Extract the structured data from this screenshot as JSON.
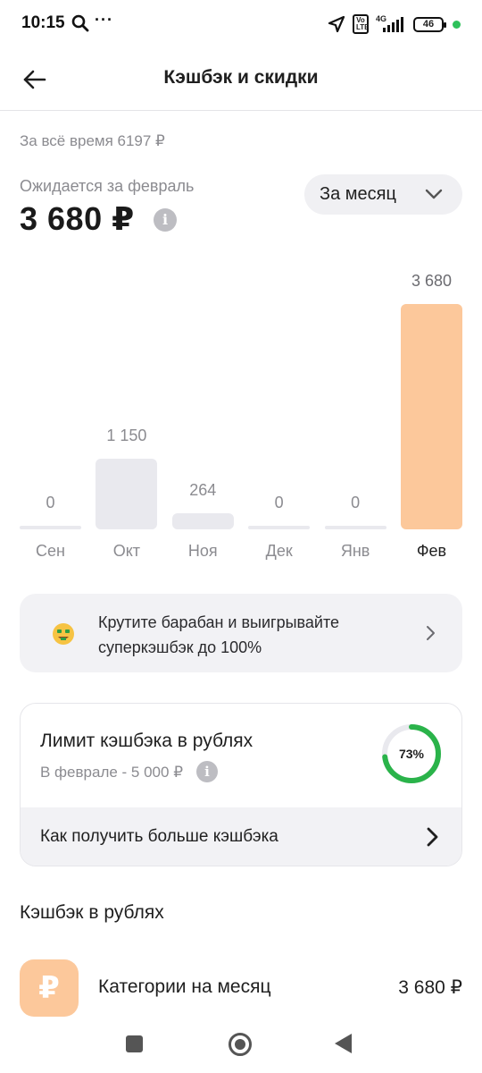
{
  "status_bar": {
    "time": "10:15",
    "dots": "···",
    "volte": "Vo LTE",
    "network": "4G",
    "battery": "46"
  },
  "header": {
    "title": "Кэшбэк и скидки"
  },
  "summary": {
    "total_all_time": "За всё время 6197 ₽",
    "expected_label": "Ожидается за февраль",
    "expected_amount": "3 680 ₽",
    "info_glyph": "i"
  },
  "period_select": {
    "value": "За месяц"
  },
  "chart_data": {
    "type": "bar",
    "categories": [
      "Сен",
      "Окт",
      "Ноя",
      "Дек",
      "Янв",
      "Фев"
    ],
    "values": [
      0,
      1150,
      264,
      0,
      0,
      3680
    ],
    "value_labels": [
      "0",
      "1 150",
      "264",
      "0",
      "0",
      "3 680"
    ],
    "highlighted_category": "Фев",
    "ylim": [
      0,
      3680
    ],
    "colors": {
      "default": "#e9e9ee",
      "highlight": "#fcc89b"
    }
  },
  "promo": {
    "text": "Крутите барабан и выигрывайте суперкэшбэк до 100%",
    "icon": "money-face-emoji-icon"
  },
  "limit": {
    "title": "Лимит кэшбэка в рублях",
    "subtitle": "В феврале - 5 000 ₽",
    "progress": 0.73,
    "progress_label": "73%",
    "progress_color": "#2ab34a",
    "link_label": "Как получить больше кэшбэка"
  },
  "section": {
    "title": "Кэшбэк в рублях"
  },
  "category": {
    "icon_glyph": "₽",
    "label": "Категории на месяц",
    "amount": "3 680 ₽"
  }
}
